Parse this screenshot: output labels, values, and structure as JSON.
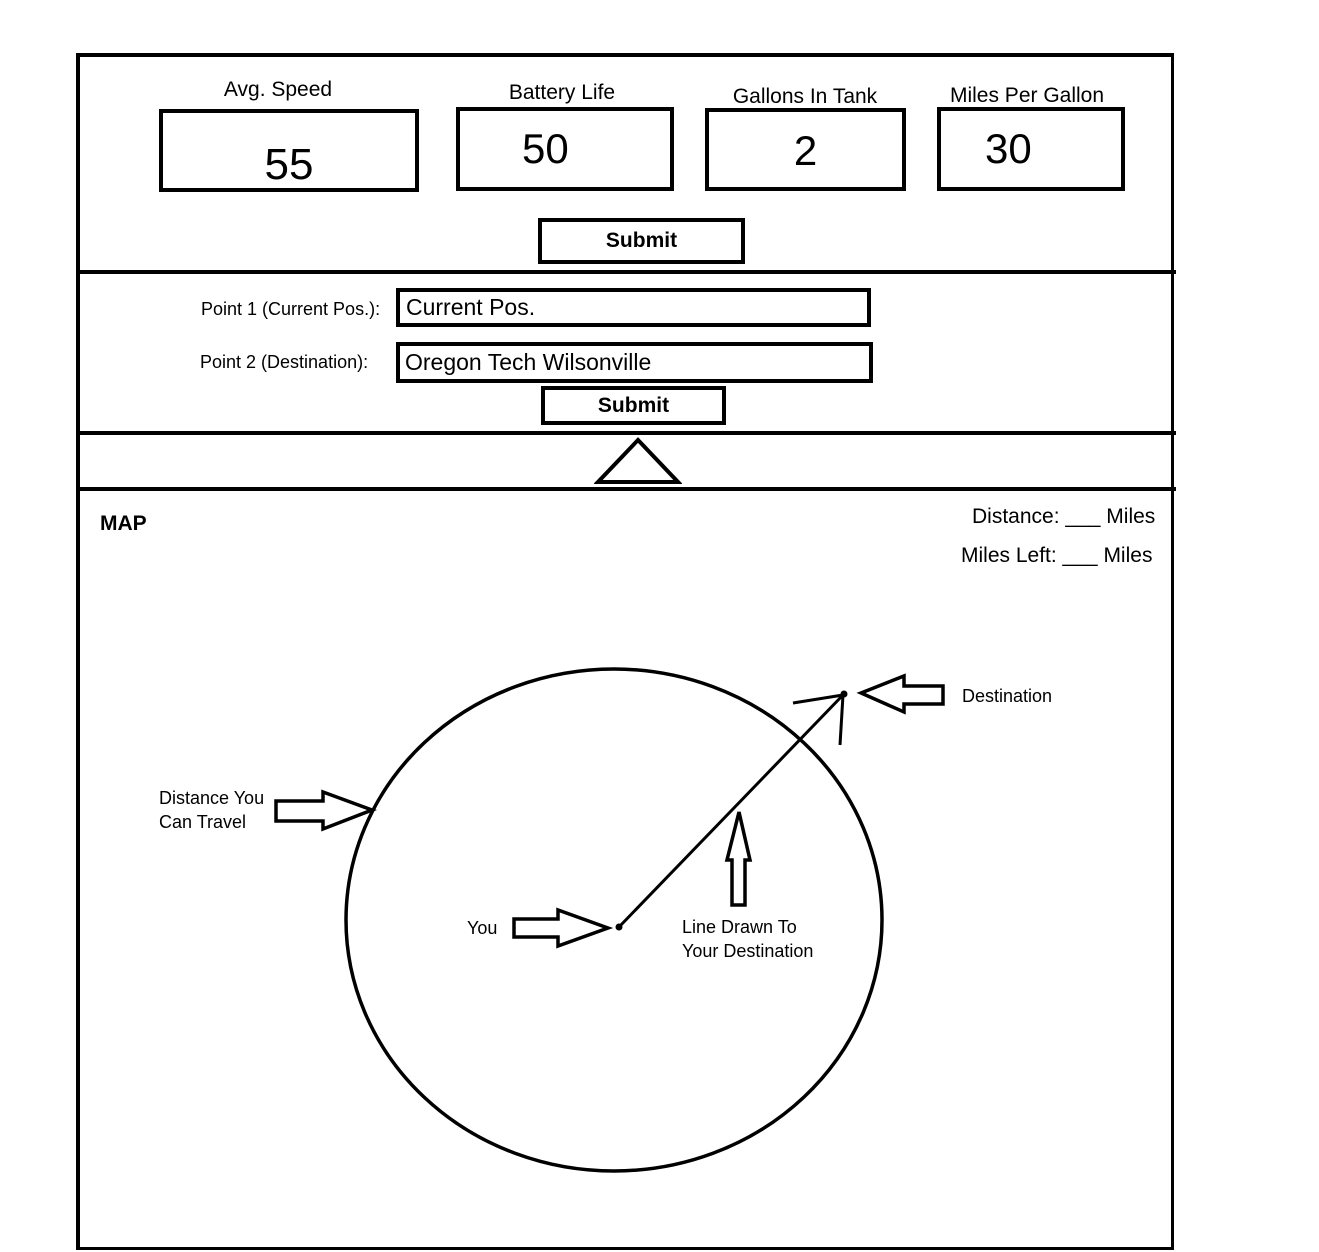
{
  "metrics": [
    {
      "label": "Avg. Speed",
      "value": "55"
    },
    {
      "label": "Battery Life",
      "value": "50"
    },
    {
      "label": "Gallons In Tank",
      "value": "2"
    },
    {
      "label": "Miles Per Gallon",
      "value": "30"
    }
  ],
  "metrics_submit": "Submit",
  "route": {
    "point1_label": "Point 1 (Current Pos.):",
    "point1_value": "Current Pos.",
    "point2_label": "Point 2 (Destination):",
    "point2_value": "Oregon Tech Wilsonville",
    "submit": "Submit"
  },
  "map": {
    "title": "MAP",
    "distance_label": "Distance:",
    "distance_blank": "___",
    "distance_unit": "Miles",
    "miles_left_label": "Miles Left:",
    "miles_left_blank": "___",
    "miles_left_unit": "Miles",
    "annotations": {
      "destination": "Destination",
      "range_line1": "Distance You",
      "range_line2": "Can Travel",
      "you": "You",
      "line_line1": "Line Drawn To",
      "line_line2": "Your Destination"
    }
  },
  "icons": {
    "collapse_toggle": "triangle-up-icon"
  }
}
